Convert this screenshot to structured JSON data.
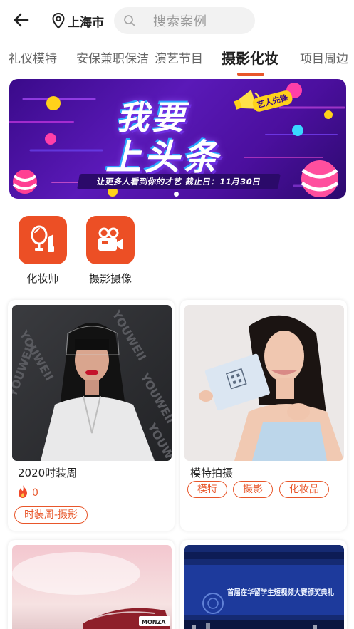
{
  "header": {
    "city": "上海市",
    "search_placeholder": "搜索案例"
  },
  "tabs": [
    "礼仪模特",
    "安保兼职保洁",
    "演艺节目",
    "摄影化妆",
    "项目周边"
  ],
  "active_tab": "摄影化妆",
  "banner": {
    "title_line1": "我要",
    "title_line2": "上头条",
    "badge": "艺人先锋",
    "subline": "让更多人看到你的才艺 截止日：11月30日",
    "slide_count": 2,
    "active_slide": 1
  },
  "categories": [
    {
      "label": "化妆师",
      "icon": "mirror-lipstick-icon"
    },
    {
      "label": "摄影摄像",
      "icon": "video-camera-icon"
    }
  ],
  "cards": [
    {
      "title": "2020时装周",
      "likes": "0",
      "tags": [
        "时装周-摄影"
      ],
      "photo_watermark": "YOUWEII"
    },
    {
      "title": "模特拍摄",
      "tags": [
        "模特",
        "摄影",
        "化妆品"
      ]
    },
    {
      "photo_text": "MONZA"
    },
    {
      "photo_text": "首届在华留学生短视频大赛颁奖典礼"
    }
  ],
  "colors": {
    "accent": "#e8562a",
    "icon_bg": "#ec4f25",
    "banner_bg": "#4b0f9e",
    "search_bg": "#f2f2f2"
  }
}
